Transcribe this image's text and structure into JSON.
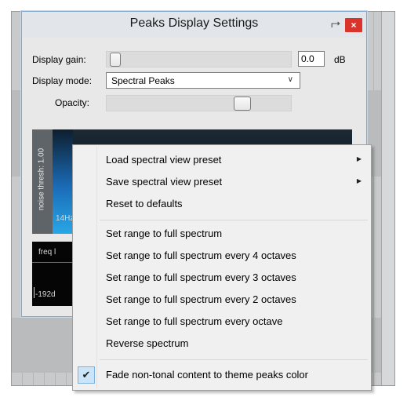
{
  "window": {
    "title": "Peaks Display Settings",
    "pin_icon": "⮣",
    "close_label": "×"
  },
  "controls": {
    "gain_label": "Display gain:",
    "gain_value": "0.0",
    "gain_unit": "dB",
    "mode_label": "Display mode:",
    "mode_value": "Spectral Peaks",
    "opacity_label": "Opacity:"
  },
  "spectral": {
    "noise_label": "noise thresh: 1.00",
    "hz_label": "14Hz",
    "freq_label": "freq l",
    "db_label": "-192d"
  },
  "menu": {
    "items": [
      {
        "label": "Load spectral view preset",
        "submenu": true
      },
      {
        "label": "Save spectral view preset",
        "submenu": true
      },
      {
        "label": "Reset to defaults"
      },
      {
        "label": "Set range to full spectrum"
      },
      {
        "label": "Set range to full spectrum every 4 octaves"
      },
      {
        "label": "Set range to full spectrum every 3 octaves"
      },
      {
        "label": "Set range to full spectrum every 2 octaves"
      },
      {
        "label": "Set range to full spectrum every octave"
      },
      {
        "label": "Reverse spectrum"
      },
      {
        "label": "Fade non-tonal content to theme peaks color",
        "checked": true
      }
    ],
    "check_glyph": "✔",
    "arrow_glyph": "▶"
  },
  "colors": {
    "close_button": "#d9332b",
    "checked_highlight": "#cce4f7",
    "window_border": "#7fa7cf"
  }
}
